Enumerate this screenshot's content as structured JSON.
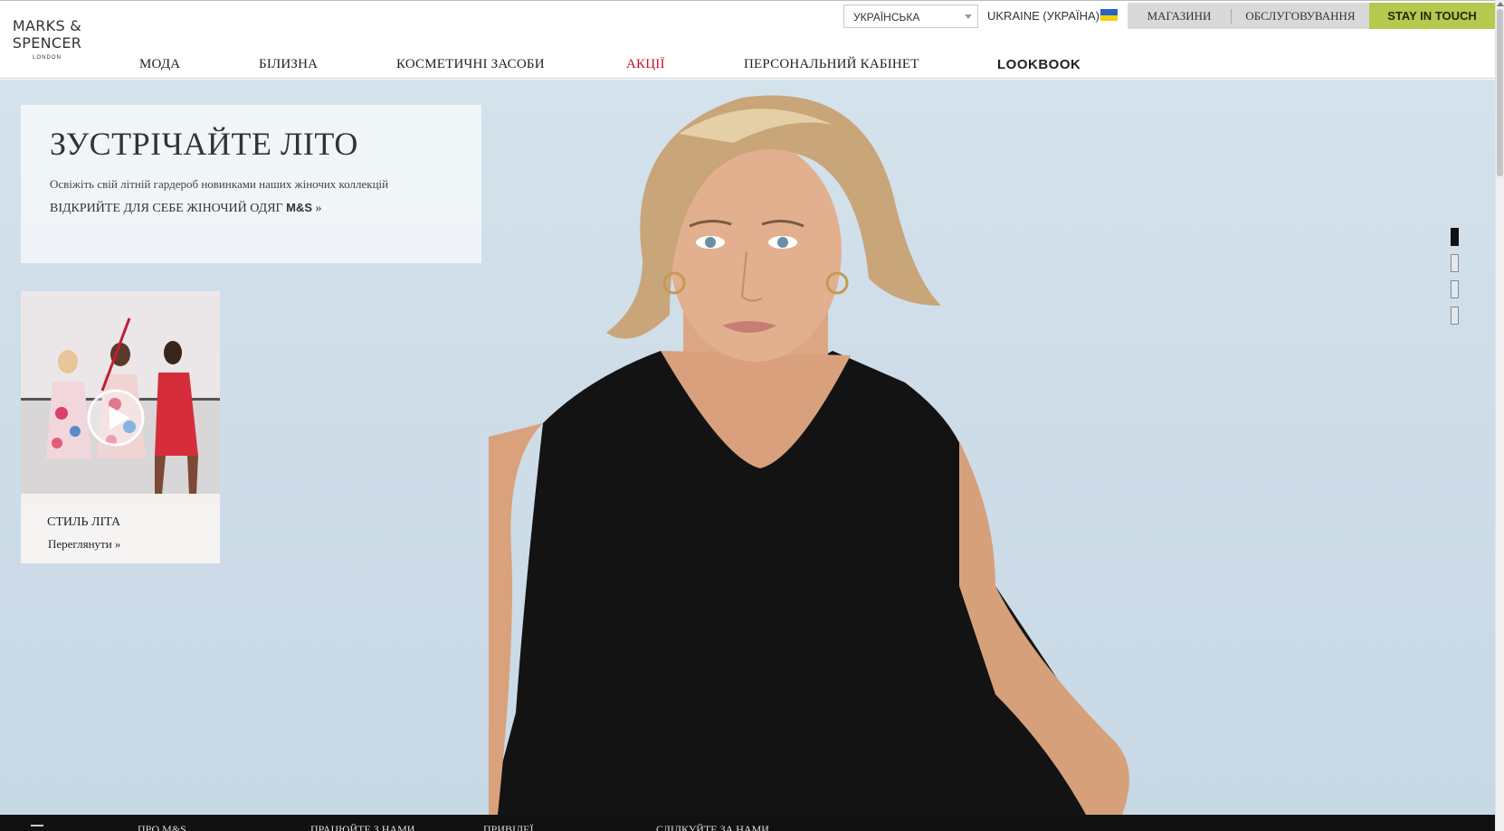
{
  "logo": {
    "line1": "MARKS &",
    "line2": "SPENCER",
    "line3": "LONDON"
  },
  "topbar": {
    "language": "УКРАЇНСЬКА",
    "country": "UKRAINE (УКРАЇНА)",
    "stores": "МАГАЗИНИ",
    "service": "ОБСЛУГОВУВАННЯ",
    "stay_in_touch": "STAY IN TOUCH"
  },
  "nav": {
    "items": [
      {
        "label": "МОДА"
      },
      {
        "label": "БІЛИЗНА"
      },
      {
        "label": "КОСМЕТИЧНІ ЗАСОБИ"
      },
      {
        "label": "АКЦІЇ"
      },
      {
        "label": "ПЕРСОНАЛЬНИЙ КАБІНЕТ"
      },
      {
        "label": "LOOKBOOK"
      }
    ]
  },
  "hero": {
    "title": "ЗУСТРІЧАЙТЕ ЛІТО",
    "subtitle": "Освіжіть свій літній гардероб новинками наших жіночих коллекцій",
    "cta_text": "ВІДКРИЙТЕ ДЛЯ СЕБЕ ЖІНОЧИЙ ОДЯГ",
    "cta_brand": "M&S",
    "cta_arrow": "»"
  },
  "video_card": {
    "title": "СТИЛЬ ЛІТА",
    "link": "Переглянути",
    "link_arrow": "»"
  },
  "slider": {
    "count": 4,
    "active_index": 0
  },
  "footer": {
    "items": [
      {
        "label": "ПРО M&S"
      },
      {
        "label": "ПРАЦЮЙТЕ З НАМИ"
      },
      {
        "label": "ПРИВІЛЕЇ"
      },
      {
        "label": "СЛІДКУЙТЕ ЗА НАМИ"
      }
    ]
  },
  "colors": {
    "accent_green": "#b4c94e",
    "sale_red": "#c8102e",
    "sky": "#cfdde8"
  }
}
